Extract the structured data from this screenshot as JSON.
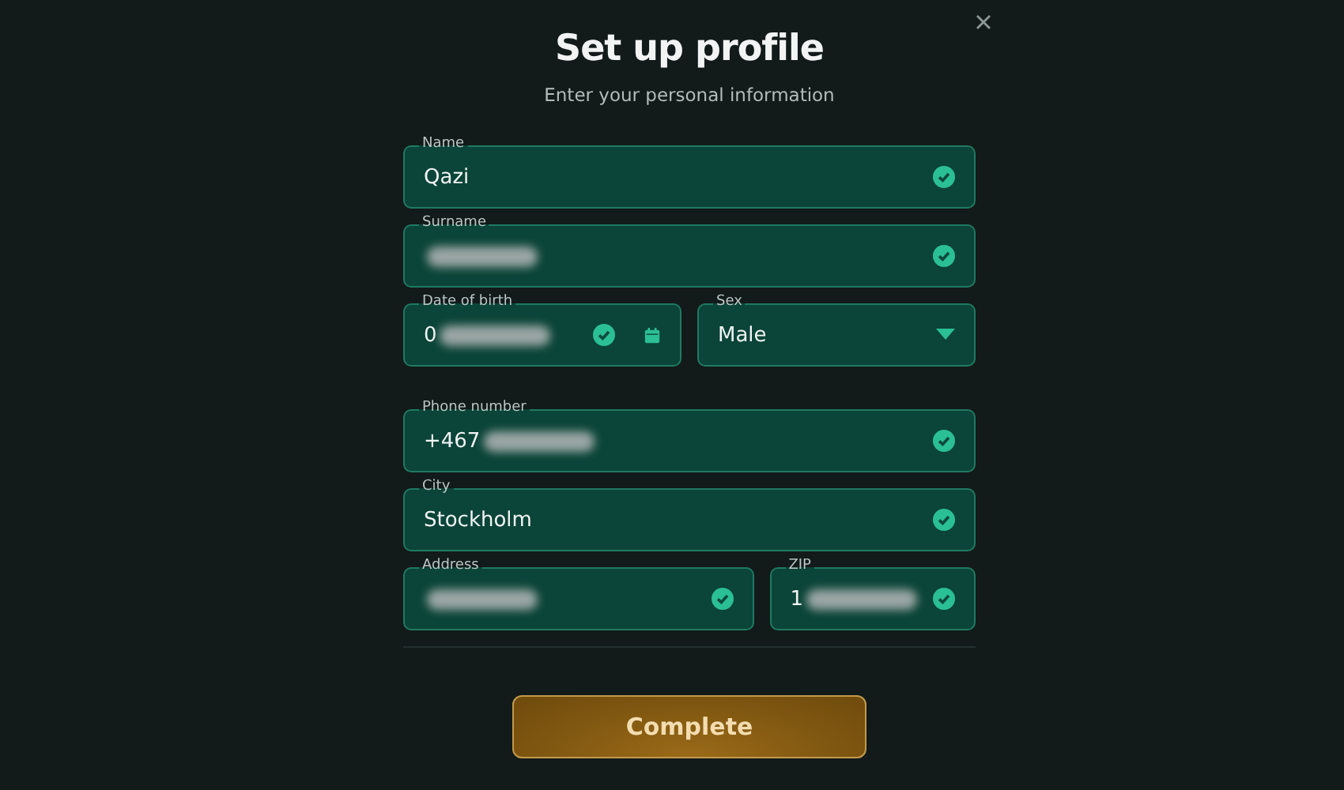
{
  "dialog": {
    "title": "Set up profile",
    "subtitle": "Enter your personal information"
  },
  "rows": [
    [
      {
        "kind": "text",
        "label": "Name",
        "value": "Qazi",
        "redacted": false,
        "valid": true
      }
    ],
    [
      {
        "kind": "text",
        "label": "Surname",
        "redacted": true,
        "valid": true
      }
    ],
    [
      {
        "kind": "date",
        "label": "Date of birth",
        "value": "0",
        "redacted": true,
        "valid": true
      },
      {
        "kind": "select",
        "label": "Sex",
        "value": "Male",
        "redacted": false,
        "valid": false
      }
    ],
    [
      {
        "kind": "text",
        "label": "Phone number",
        "value": "+467",
        "redacted": true,
        "valid": true
      }
    ],
    [
      {
        "kind": "text",
        "label": "City",
        "value": "Stockholm",
        "redacted": false,
        "valid": true
      }
    ],
    [
      {
        "kind": "text",
        "label": "Address",
        "redacted": true,
        "valid": true
      },
      {
        "kind": "text",
        "label": "ZIP",
        "value": "1",
        "redacted": true,
        "valid": true
      }
    ]
  ],
  "complete_button": "Complete"
}
